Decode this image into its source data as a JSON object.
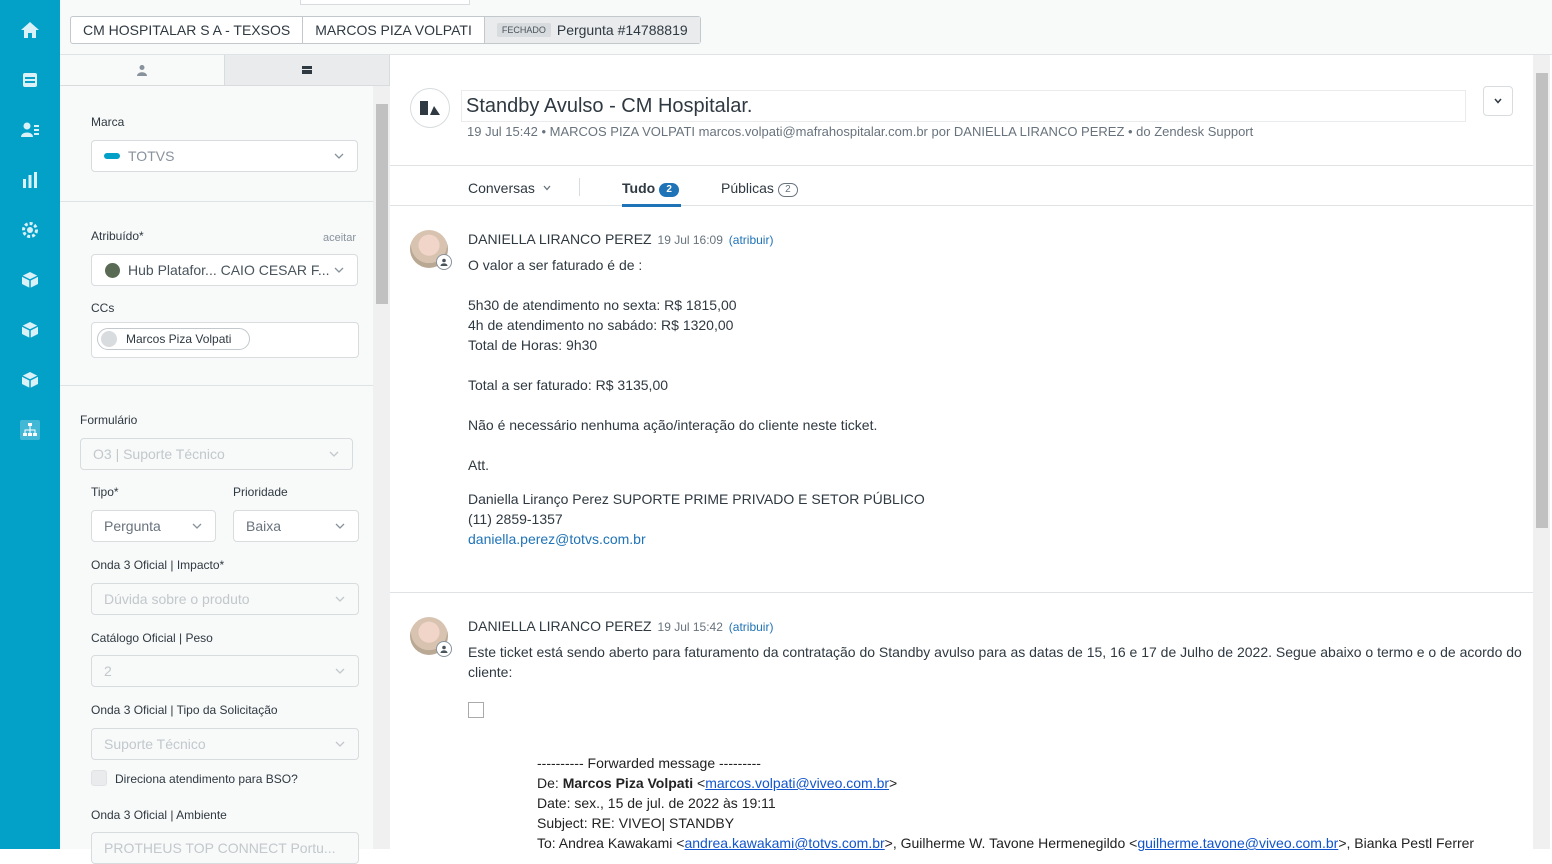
{
  "tabs": {
    "org": "CM HOSPITALAR S A - TEXSOS",
    "requester": "MARCOS PIZA VOLPATI",
    "status_badge": "FECHADO",
    "ticket": "Pergunta #14788819"
  },
  "panel": {
    "brand_label": "Marca",
    "brand_value": "TOTVS",
    "assignee_label": "Atribuído*",
    "assignee_action": "aceitar",
    "assignee_value": "Hub Platafor...  CAIO CESAR F...",
    "ccs_label": "CCs",
    "cc_person": "Marcos Piza Volpati",
    "form_label": "Formulário",
    "form_value": "O3 | Suporte Técnico",
    "type_label": "Tipo*",
    "type_value": "Pergunta",
    "priority_label": "Prioridade",
    "priority_value": "Baixa",
    "impact_label": "Onda 3 Oficial | Impacto*",
    "impact_value": "Dúvida sobre o produto",
    "catalog_label": "Catálogo Oficial | Peso",
    "catalog_value": "2",
    "request_type_label": "Onda 3 Oficial | Tipo da Solicitação",
    "request_type_value": "Suporte Técnico",
    "bso_label": "Direciona atendimento para BSO?",
    "environment_label": "Onda 3 Oficial | Ambiente",
    "environment_value": "PROTHEUS TOP CONNECT Portu..."
  },
  "ticket": {
    "subject": "Standby Avulso - CM Hospitalar.",
    "meta": "19 Jul 15:42 • MARCOS PIZA VOLPATI   marcos.volpati@mafrahospitalar.com.br por DANIELLA LIRANCO PEREZ • do Zendesk Support"
  },
  "conversation_tabs": {
    "conversations": "Conversas",
    "all": "Tudo",
    "all_count": "2",
    "public": "Públicas",
    "public_count": "2"
  },
  "comments": [
    {
      "author": "DANIELLA LIRANCO PEREZ",
      "time": "19 Jul 16:09",
      "assign": "(atribuir)",
      "lines": [
        "O valor a ser faturado é de :",
        "5h30 de atendimento no sexta: R$ 1815,00",
        "4h de atendimento no sabádo: R$ 1320,00",
        "Total de Horas: 9h30",
        "Total a ser faturado: R$ 3135,00",
        "Não é necessário nenhuma ação/interação do cliente neste ticket.",
        "Att.",
        "Daniella Liranço Perez SUPORTE PRIME PRIVADO E SETOR PÚBLICO",
        "(11) 2859-1357",
        "daniella.perez@totvs.com.br"
      ]
    },
    {
      "author": "DANIELLA LIRANCO PEREZ",
      "time": "19 Jul 15:42",
      "assign": "(atribuir)",
      "lines": [
        "Este ticket está sendo aberto para faturamento da contratação do Standby avulso para as datas de 15, 16 e 17 de Julho de 2022. Segue abaixo o termo e o de acordo do",
        "cliente:"
      ],
      "forward": {
        "header": "---------- Forwarded message ---------",
        "from_label": "De: ",
        "from_name": "Marcos Piza Volpati",
        "from_email": "marcos.volpati@viveo.com.br",
        "date": "Date: sex., 15 de jul. de 2022 às 19:11",
        "subject": "Subject: RE: VIVEO| STANDBY",
        "to_label": "To: Andrea Kawakami <",
        "to_email1": "andrea.kawakami@totvs.com.br",
        "to_mid": ">, Guilherme W. Tavone Hermenegildo <",
        "to_email2": "guilherme.tavone@viveo.com.br",
        "to_end": ">, Bianka Pestl Ferrer"
      }
    }
  ]
}
